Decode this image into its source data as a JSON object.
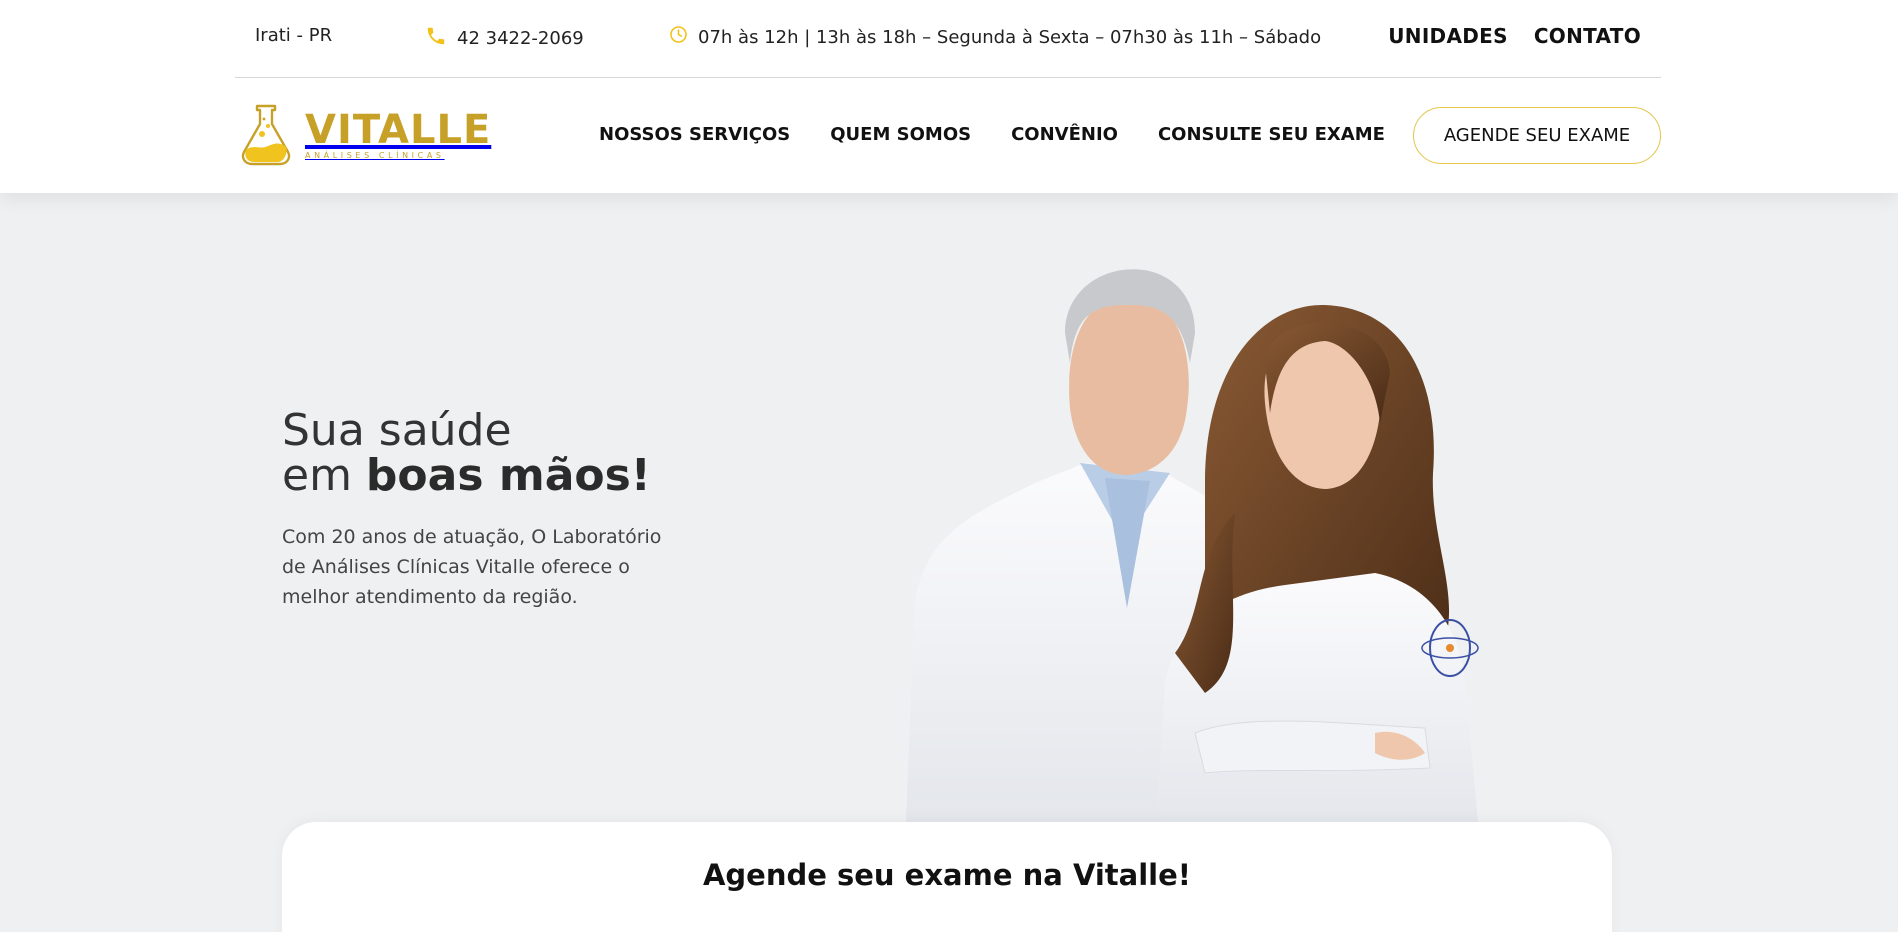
{
  "topbar": {
    "city": "Irati - PR",
    "phone": "42 3422-2069",
    "hours": "07h às 12h | 13h às 18h – Segunda à Sexta – 07h30 às 11h – Sábado",
    "links": [
      "UNIDADES",
      "CONTATO"
    ]
  },
  "brand": {
    "name": "VITALLE",
    "tagline": "ANÁLISES CLÍNICAS",
    "color": "#c7a028"
  },
  "nav": {
    "items": [
      "NOSSOS SERVIÇOS",
      "QUEM SOMOS",
      "CONVÊNIO",
      "CONSULTE SEU EXAME"
    ],
    "cta": "AGENDE SEU EXAME"
  },
  "hero": {
    "title_line1": "Sua saúde",
    "title_line2_prefix": "em ",
    "title_line2_bold": "boas mãos!",
    "text": "Com 20 anos de atuação, O Laboratório de Análises Clínicas Vitalle oferece o melhor atendimento da região."
  },
  "booking": {
    "part1": "Agende seu ",
    "part2": "exame",
    "part3": " na ",
    "part4": "Vitalle!"
  },
  "icons": {
    "phone": "phone-icon",
    "clock": "clock-icon",
    "accent": "#f2c21a"
  }
}
